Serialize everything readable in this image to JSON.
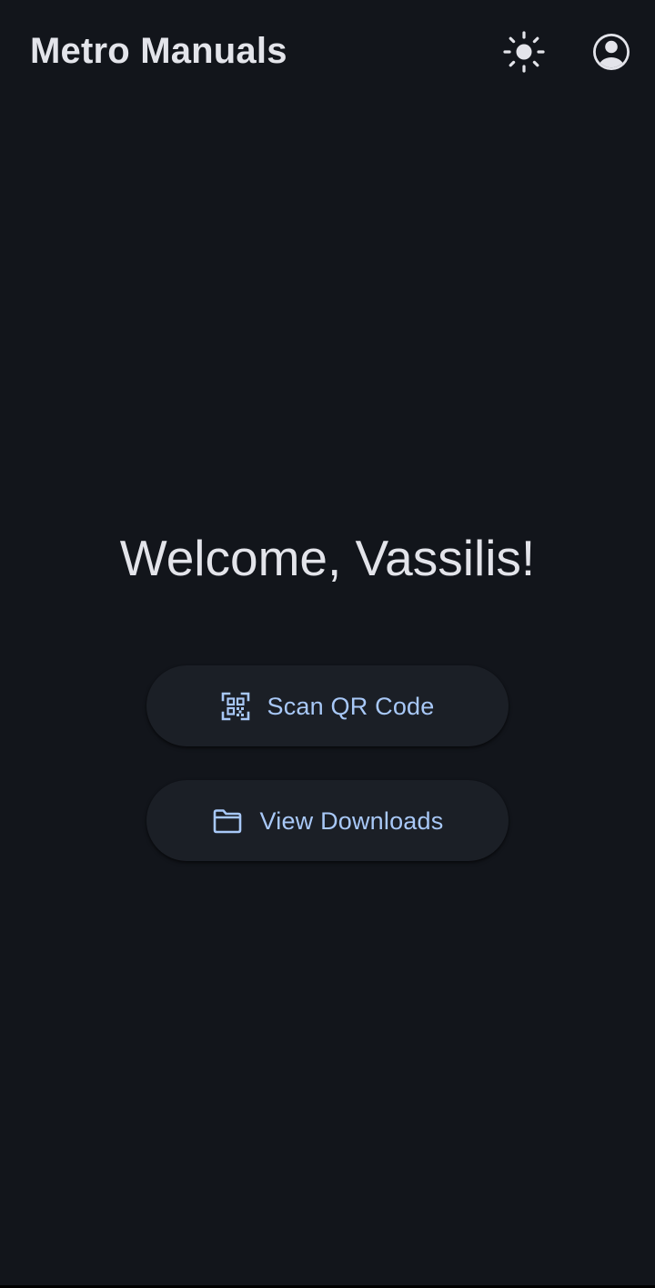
{
  "app_bar": {
    "title": "Metro Manuals",
    "theme_icon": "sun-icon",
    "account_icon": "account-circle-icon"
  },
  "main": {
    "welcome_text": "Welcome, Vassilis!",
    "actions": [
      {
        "label": "Scan QR Code",
        "icon": "qr-code-scanner-icon"
      },
      {
        "label": "View Downloads",
        "icon": "folder-icon"
      }
    ]
  },
  "colors": {
    "background": "#12151b",
    "text_primary": "#e3e4ea",
    "button_surface": "#1b1f26",
    "accent": "#a8c8f7"
  }
}
